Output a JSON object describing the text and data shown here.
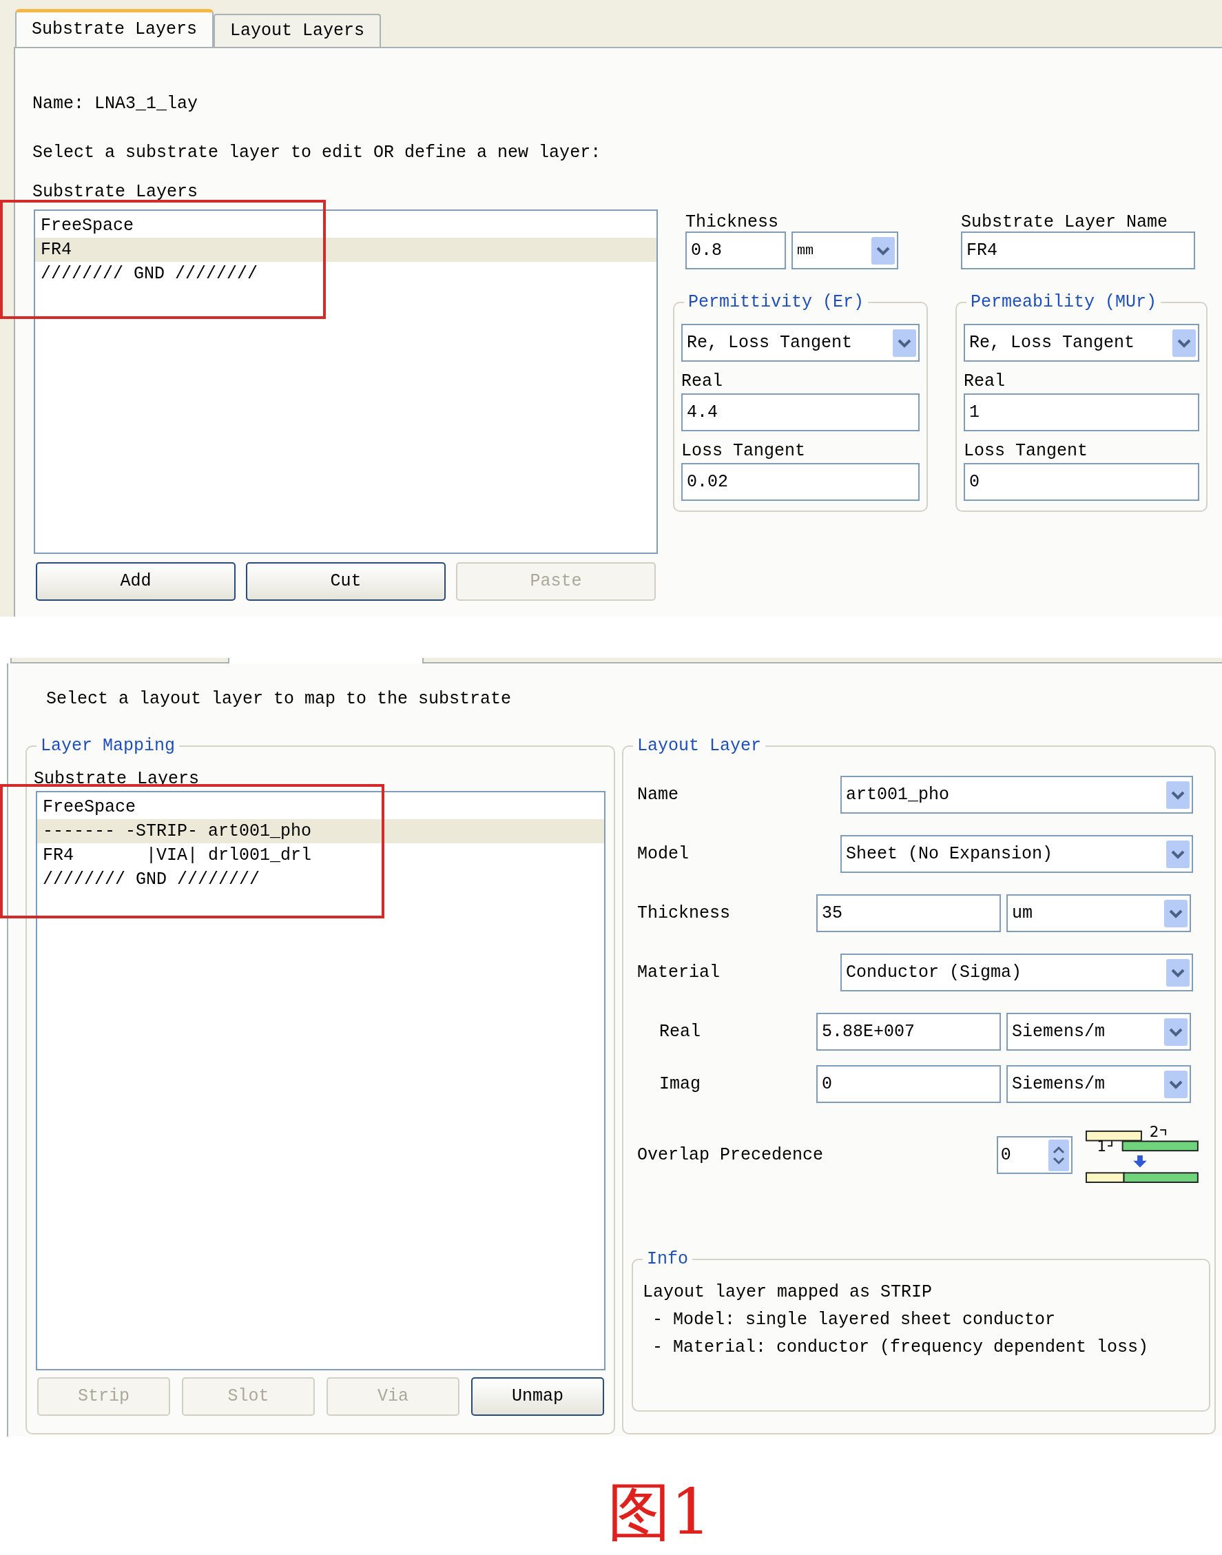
{
  "substrate_panel": {
    "tabs": [
      {
        "label": "Substrate Layers",
        "selected": true
      },
      {
        "label": "Layout Layers",
        "selected": false
      }
    ],
    "name_line": "Name: LNA3_1_lay",
    "instruction": "Select a substrate layer to edit OR define a new layer:",
    "list_label": "Substrate Layers",
    "layers": [
      {
        "text": "FreeSpace",
        "selected": false
      },
      {
        "text": "FR4",
        "selected": true
      },
      {
        "text": "//////// GND ////////",
        "selected": false
      }
    ],
    "buttons": [
      {
        "label": "Add",
        "disabled": false
      },
      {
        "label": "Cut",
        "disabled": false
      },
      {
        "label": "Paste",
        "disabled": true
      }
    ],
    "thickness": {
      "label": "Thickness",
      "value": "0.8",
      "unit": "mm"
    },
    "layer_name": {
      "label": "Substrate Layer Name",
      "value": "FR4"
    },
    "groups": [
      {
        "title": "Permittivity (Er)",
        "mode": "Re, Loss Tangent",
        "real_label": "Real",
        "real": "4.4",
        "loss_label": "Loss Tangent",
        "loss": "0.02"
      },
      {
        "title": "Permeability (MUr)",
        "mode": "Re, Loss Tangent",
        "real_label": "Real",
        "real": "1",
        "loss_label": "Loss Tangent",
        "loss": "0"
      }
    ]
  },
  "layout_panel": {
    "instruction": "Select a layout layer to map to the substrate",
    "mapping": {
      "title": "Layer Mapping",
      "list_label": "Substrate Layers",
      "rows": [
        {
          "text": "FreeSpace",
          "selected": false
        },
        {
          "text": "------- -STRIP- art001_pho",
          "selected": true
        },
        {
          "text": "FR4       |VIA| drl001_drl",
          "selected": false
        },
        {
          "text": "//////// GND ////////",
          "selected": false
        }
      ],
      "buttons": [
        {
          "label": "Strip",
          "disabled": true
        },
        {
          "label": "Slot",
          "disabled": true
        },
        {
          "label": "Via",
          "disabled": true
        },
        {
          "label": "Unmap",
          "disabled": false
        }
      ]
    },
    "layer": {
      "title": "Layout Layer",
      "fields": [
        {
          "kind": "select",
          "label": "Name",
          "value": "art001_pho",
          "indented": false
        },
        {
          "kind": "select",
          "label": "Model",
          "value": "Sheet (No Expansion)",
          "indented": false
        },
        {
          "kind": "value_unit",
          "label": "Thickness",
          "value": "35",
          "unit": "um",
          "indented": false
        },
        {
          "kind": "select",
          "label": "Material",
          "value": "Conductor (Sigma)",
          "indented": false
        },
        {
          "kind": "value_unit",
          "label": "Real",
          "value": "5.88E+007",
          "unit": "Siemens/m",
          "indented": true
        },
        {
          "kind": "value_unit",
          "label": "Imag",
          "value": "0",
          "unit": "Siemens/m",
          "indented": true
        }
      ],
      "overlap": {
        "label": "Overlap Precedence",
        "value": "0",
        "diagram_labels": [
          "2",
          "1"
        ]
      },
      "info": {
        "title": "Info",
        "lines": [
          "Layout layer mapped as STRIP",
          "- Model: single layered sheet conductor",
          "- Material: conductor (frequency dependent loss)"
        ]
      }
    }
  },
  "caption": "图1"
}
